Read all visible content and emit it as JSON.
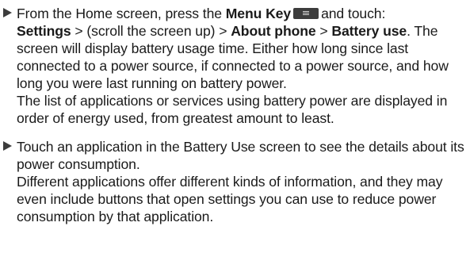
{
  "item1": {
    "intro": "From the Home screen, press the",
    "menu_key": "Menu Key",
    "menu_key_icon": "menu-key-icon",
    "after_key": "and touch:",
    "path_settings": "Settings",
    "sep_scroll": "> (scroll the screen up) >",
    "path_about": "About phone",
    "sep_gt": ">",
    "path_battery": "Battery use",
    "period": ".",
    "description": "The screen will display battery usage time. Either how long since last connected to a power source, if connected to a power source, and how long you were last running on battery power.",
    "list_note": "The list of applications or services using battery power are displayed in order of energy used, from greatest amount to least."
  },
  "item2": {
    "instruction": "Touch an application in the Battery Use screen to see the details about its power consumption.",
    "info_note": "Different applications offer different kinds of information, and they may even include buttons that open settings you can use to reduce power consumption by that application."
  }
}
